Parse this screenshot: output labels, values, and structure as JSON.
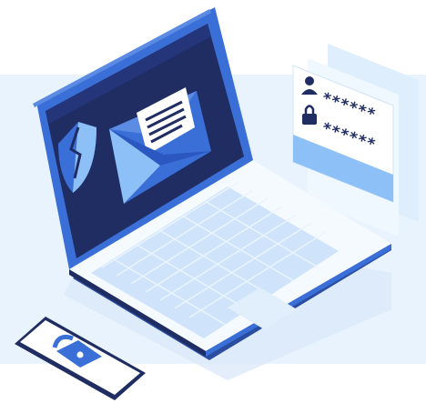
{
  "login_card": {
    "username_mask": "******",
    "password_mask": "******"
  },
  "icons": [
    "shield-icon",
    "envelope-icon",
    "document-icon",
    "user-icon",
    "padlock-icon",
    "open-padlock-icon"
  ],
  "colors": {
    "navy": "#1f2d63",
    "screen_blue": "#3b6fd8",
    "light_blue": "#cfe4fb",
    "panel_blue": "#e9f3fd",
    "accent_blue": "#8dc0f7"
  }
}
